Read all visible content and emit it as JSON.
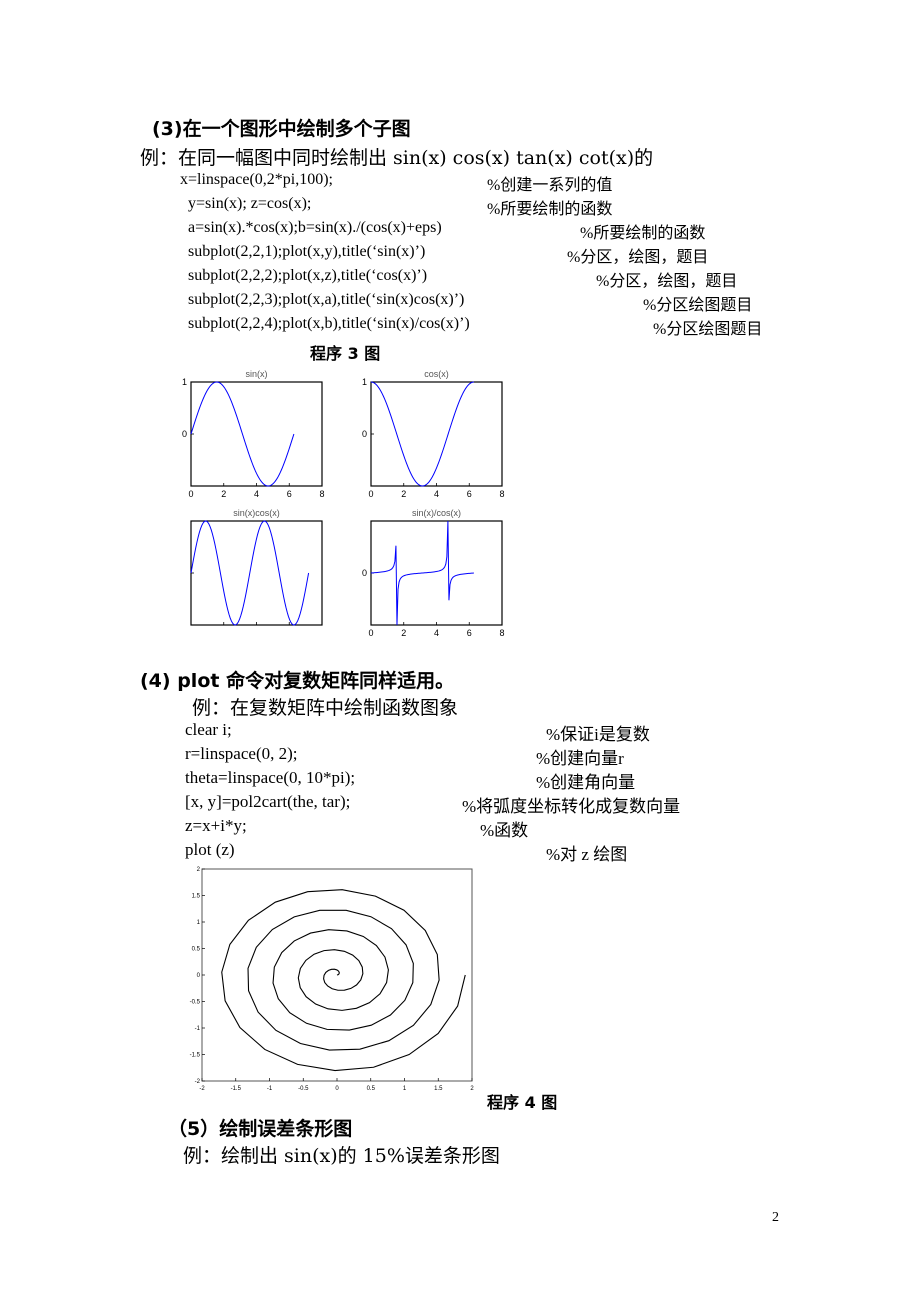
{
  "page_number": "2",
  "section3": {
    "heading": "(3)在一个图形中绘制多个子图",
    "example": "例：在同一幅图中同时绘制出 sin(x) cos(x) tan(x) cot(x)的",
    "code_lines": [
      {
        "code": "x=linspace(0,2*pi,100);",
        "comment": "%创建一系列的值"
      },
      {
        "code": "y=sin(x); z=cos(x);",
        "comment": "%所要绘制的函数"
      },
      {
        "code": "a=sin(x).*cos(x);b=sin(x)./(cos(x)+eps)",
        "comment": "%所要绘制的函数"
      },
      {
        "code": "subplot(2,2,1);plot(x,y),title(‘sin(x)’)",
        "comment": "%分区，绘图，题目"
      },
      {
        "code": "subplot(2,2,2);plot(x,z),title(‘cos(x)’)",
        "comment": "%分区，绘图，题目"
      },
      {
        "code": "subplot(2,2,3);plot(x,a),title(‘sin(x)cos(x)’)",
        "comment": "%分区绘图题目"
      },
      {
        "code": "subplot(2,2,4);plot(x,b),title(‘sin(x)/cos(x)’)",
        "comment": "%分区绘图题目"
      }
    ],
    "figure_caption": "程序 3 图"
  },
  "section4": {
    "heading": "(4) plot 命令对复数矩阵同样适用。",
    "example": "例：在复数矩阵中绘制函数图象",
    "code_lines": [
      {
        "code": "clear i;",
        "comment": "%保证i是复数"
      },
      {
        "code": "r=linspace(0, 2);",
        "comment": "%创建向量r"
      },
      {
        "code": "theta=linspace(0, 10*pi);",
        "comment": "%创建角向量"
      },
      {
        "code": "[x, y]=pol2cart(the, tar);",
        "comment": "%将弧度坐标转化成复数向量"
      },
      {
        "code": "z=x+i*y;",
        "comment": "%函数"
      },
      {
        "code": "plot (z)",
        "comment": "%对 z 绘图"
      }
    ],
    "figure_caption": "程序 4 图"
  },
  "section5": {
    "heading": "（5）绘制误差条形图",
    "example": "例：绘制出 sin(x)的 15%误差条形图"
  },
  "chart_data": [
    {
      "type": "line",
      "title": "sin(x)",
      "function": "sin(x)",
      "x_range": [
        0,
        6.2832
      ],
      "samples": 100,
      "xlim": [
        0,
        8
      ],
      "ylim": [
        -1,
        1
      ],
      "xticks": [
        "0",
        "2",
        "4",
        "6",
        "8"
      ],
      "yticks": [
        "1",
        "0",
        ""
      ],
      "series_color": "#0000ff"
    },
    {
      "type": "line",
      "title": "cos(x)",
      "function": "cos(x)",
      "x_range": [
        0,
        6.2832
      ],
      "samples": 100,
      "xlim": [
        0,
        8
      ],
      "ylim": [
        -1,
        1
      ],
      "xticks": [
        "0",
        "2",
        "4",
        "6",
        "8"
      ],
      "yticks": [
        "1",
        "0",
        ""
      ],
      "series_color": "#0000ff"
    },
    {
      "type": "line",
      "title": "sin(x)cos(x)",
      "function": "sin(x)*cos(x)",
      "x_range": [
        0,
        6.2832
      ],
      "samples": 100,
      "xlim": [
        0,
        7
      ],
      "ylim": [
        -0.5,
        0.5
      ],
      "xticks": [
        "",
        "",
        "",
        "",
        ""
      ],
      "yticks": [
        "",
        "",
        ""
      ],
      "series_color": "#0000ff"
    },
    {
      "type": "line",
      "title": "sin(x)/cos(x)",
      "function": "sin(x)/(cos(x)+eps)",
      "x_range": [
        0,
        6.2832
      ],
      "samples": 100,
      "xlim": [
        0,
        8
      ],
      "ylim": [
        -40,
        40
      ],
      "xticks": [
        "0",
        "2",
        "4",
        "6",
        "8"
      ],
      "yticks": [
        "",
        "0",
        ""
      ],
      "series_color": "#0000ff"
    },
    {
      "type": "line",
      "title": "",
      "function": "spiral r=linspace(0,2), theta=linspace(0,10*pi)",
      "samples": 100,
      "xlim": [
        -2,
        2
      ],
      "ylim": [
        -2,
        2
      ],
      "xticks": [
        "-2",
        "-1.5",
        "-1",
        "-0.5",
        "0",
        "0.5",
        "1",
        "1.5",
        "2"
      ],
      "yticks": [
        "2",
        "1.5",
        "1",
        "0.5",
        "0",
        "-0.5",
        "-1",
        "-1.5",
        "-2"
      ],
      "series_color": "#000000"
    }
  ]
}
